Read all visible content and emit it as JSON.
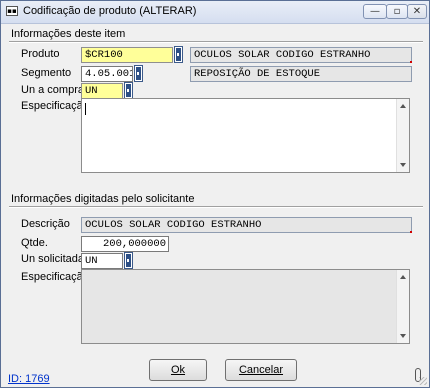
{
  "window": {
    "title": "Codificação de produto (ALTERAR)",
    "buttons": {
      "minimize": "—",
      "maximize": "▫",
      "close": "✕"
    }
  },
  "item_section": {
    "title": "Informações deste item",
    "produto_label": "Produto",
    "produto_value": "$CR100",
    "produto_desc": "OCULOS SOLAR CODIGO ESTRANHO",
    "segmento_label": "Segmento",
    "segmento_value": "4.05.001",
    "segmento_desc": "REPOSIÇÃO DE ESTOQUE",
    "unidade_label": "Un a comprar",
    "unidade_value": "UN",
    "especificacao_label": "Especificação",
    "especificacao_value": ""
  },
  "solicitante_section": {
    "title": "Informações digitadas pelo solicitante",
    "descricao_label": "Descrição",
    "descricao_value": "OCULOS SOLAR CODIGO ESTRANHO",
    "qtde_label": "Qtde.",
    "qtde_value": "200,000000",
    "unidade_label": "Un solicitada",
    "unidade_value": "UN",
    "especificacao_label": "Especificação",
    "especificacao_value": ""
  },
  "footer": {
    "ok_label": "Ok",
    "cancel_label": "Cancelar",
    "id_link": "ID: 1769"
  }
}
